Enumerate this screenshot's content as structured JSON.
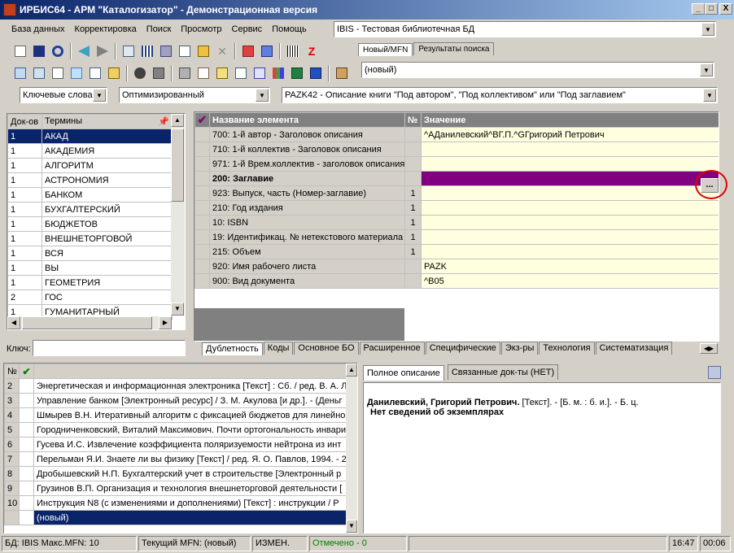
{
  "window": {
    "title": "ИРБИС64 - АРМ \"Каталогизатор\" - Демонстрационная версия",
    "minimize": "_",
    "maximize": "□",
    "close": "X"
  },
  "menu": [
    "База данных",
    "Корректировка",
    "Поиск",
    "Просмотр",
    "Сервис",
    "Помощь"
  ],
  "db_selector": {
    "value": "IBIS - Тестовая библиотечная БД"
  },
  "record_tabs": [
    "Новый/MFN",
    "Результаты поиска"
  ],
  "record_combo": {
    "value": "(новый)"
  },
  "search_bar": {
    "mode": "Ключевые слова",
    "optimization": "Оптимизированный",
    "worksheet": "PAZK42 - Описание книги \"Под автором\", \"Под коллективом\" или \"Под заглавием\""
  },
  "terms": {
    "headers": [
      "Док-ов",
      "Термины"
    ],
    "rows": [
      {
        "count": "1",
        "term": "АКАД"
      },
      {
        "count": "1",
        "term": "АКАДЕМИЯ"
      },
      {
        "count": "1",
        "term": "АЛГОРИТМ"
      },
      {
        "count": "1",
        "term": "АСТРОНОМИЯ"
      },
      {
        "count": "1",
        "term": "БАНКОМ"
      },
      {
        "count": "1",
        "term": "БУХГАЛТЕРСКИЙ"
      },
      {
        "count": "1",
        "term": "БЮДЖЕТОВ"
      },
      {
        "count": "1",
        "term": "ВНЕШНЕТОРГОВОЙ"
      },
      {
        "count": "1",
        "term": "ВСЯ"
      },
      {
        "count": "1",
        "term": "ВЫ"
      },
      {
        "count": "1",
        "term": "ГЕОМЕТРИЯ"
      },
      {
        "count": "2",
        "term": "ГОС"
      },
      {
        "count": "1",
        "term": "ГУМАНИТАРНЫЙ"
      }
    ],
    "key_label": "Ключ:",
    "key_value": ""
  },
  "fields": {
    "headers": [
      "Название элемента",
      "№",
      "Значение"
    ],
    "rows": [
      {
        "name": "700: 1-й  автор - Заголовок описания",
        "num": "",
        "value": "^AДанилевский^BГ.П.^GГригорий Петрович",
        "bold": false,
        "sel": false
      },
      {
        "name": "710: 1-й коллектив - Заголовок описания",
        "num": "",
        "value": "",
        "bold": false,
        "sel": false
      },
      {
        "name": "971: 1-й Врем.коллектив - заголовок описания",
        "num": "",
        "value": "",
        "bold": false,
        "sel": false
      },
      {
        "name": "200: Заглавие",
        "num": "",
        "value": "",
        "bold": true,
        "sel": true
      },
      {
        "name": "923: Выпуск, часть (Номер-заглавие)",
        "num": "1",
        "value": "",
        "bold": false,
        "sel": false
      },
      {
        "name": "210: Год издания",
        "num": "1",
        "value": "",
        "bold": false,
        "sel": false
      },
      {
        "name": "10: ISBN",
        "num": "1",
        "value": "",
        "bold": false,
        "sel": false
      },
      {
        "name": "19: Идентификац. № нетекстового материала",
        "num": "1",
        "value": "",
        "bold": false,
        "sel": false
      },
      {
        "name": "215: Объем",
        "num": "1",
        "value": "",
        "bold": false,
        "sel": false
      },
      {
        "name": "920: Имя рабочего листа",
        "num": "",
        "value": "PAZK",
        "bold": false,
        "sel": false
      },
      {
        "name": "900: Вид документа",
        "num": "",
        "value": "^B05",
        "bold": false,
        "sel": false
      }
    ],
    "ellipsis": "..."
  },
  "worksheet_tabs": [
    "Дублетность",
    "Коды",
    "Основное БО",
    "Расширенное",
    "Специфические",
    "Экз-ры",
    "Технология",
    "Систематизация"
  ],
  "records": {
    "headers": [
      "№"
    ],
    "rows": [
      {
        "n": "2",
        "text": "Энергетическая и информационная электроника [Текст] : Сб. / ред. В. А. Л"
      },
      {
        "n": "3",
        "text": "Управление банком [Электронный ресурс]  / З. М. Акулова [и др.]. - (Деньг"
      },
      {
        "n": "4",
        "text": "Шмырев В.Н. Итеративный алгоритм с фиксацией бюджетов для линейно"
      },
      {
        "n": "5",
        "text": "Городниченковский, Виталий Максимович. Почти ортогональность инвари"
      },
      {
        "n": "6",
        "text": "Гусева И.С. Извлечение коэффициента поляризуемости нейтрона из инт"
      },
      {
        "n": "7",
        "text": "Перельман Я.И. Знаете ли вы физику [Текст] / ред. Я. О. Павлов, 1994. - 2"
      },
      {
        "n": "8",
        "text": "Дробышевский Н.П. Бухгалтерский учет в строительстве [Электронный р"
      },
      {
        "n": "9",
        "text": "Грузинов В.П. Организация и технология внешнеторговой деятельности ["
      },
      {
        "n": "10",
        "text": "Инструкция N8   (с изменениями и дополнениями) [Текст] : инструкции / Р"
      },
      {
        "n": "",
        "text": "(новый)"
      }
    ]
  },
  "desc_tabs": [
    "Полное описание",
    "Связанные док-ты (НЕТ)"
  ],
  "description": {
    "line1_bold": "Данилевский, Григорий Петрович.",
    "line1_rest": " [Текст]. - [Б. м. : б. и.]. - Б. ц.",
    "line2": "Нет сведений об экземплярах"
  },
  "status": {
    "db": "БД: IBIS Макс.MFN: 10",
    "mfn": "Текущий MFN: (новый)",
    "changed": "ИЗМЕН.",
    "marked": "Отмечено - 0",
    "time": "16:47",
    "elapsed": "00:06"
  },
  "colors": {
    "selected_row": "#800080",
    "values_bg": "#ffffe0",
    "marked_text": "#008000"
  }
}
